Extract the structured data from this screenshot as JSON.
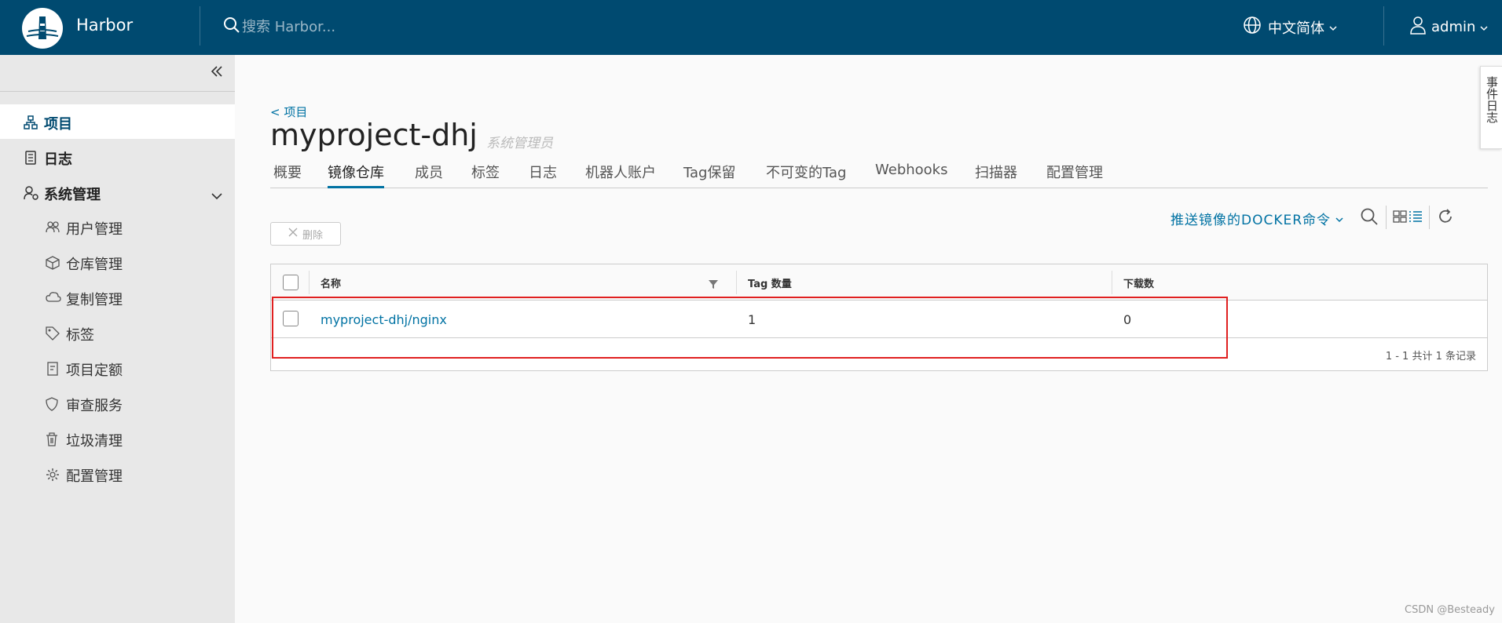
{
  "header": {
    "app_title": "Harbor",
    "search_placeholder": "搜索 Harbor...",
    "language": "中文简体",
    "user": "admin"
  },
  "sidebar": {
    "items": [
      {
        "label": "项目",
        "icon": "projects-icon"
      },
      {
        "label": "日志",
        "icon": "logs-icon"
      },
      {
        "label": "系统管理",
        "icon": "system-admin-icon"
      }
    ],
    "sub_items": [
      {
        "label": "用户管理",
        "icon": "users-icon"
      },
      {
        "label": "仓库管理",
        "icon": "registries-icon"
      },
      {
        "label": "复制管理",
        "icon": "replication-icon"
      },
      {
        "label": "标签",
        "icon": "tag-icon"
      },
      {
        "label": "项目定额",
        "icon": "quota-icon"
      },
      {
        "label": "审查服务",
        "icon": "shield-icon"
      },
      {
        "label": "垃圾清理",
        "icon": "trash-icon"
      },
      {
        "label": "配置管理",
        "icon": "gear-icon"
      }
    ]
  },
  "main": {
    "breadcrumb": "< 项目",
    "title": "myproject-dhj",
    "role": "系统管理员",
    "tabs": [
      "概要",
      "镜像仓库",
      "成员",
      "标签",
      "日志",
      "机器人账户",
      "Tag保留",
      "不可变的Tag",
      "Webhooks",
      "扫描器",
      "配置管理"
    ],
    "active_tab": "镜像仓库",
    "push_command": "推送镜像的DOCKER命令",
    "delete_label": "删除",
    "columns": [
      "名称",
      "Tag 数量",
      "下载数"
    ],
    "rows": [
      {
        "name": "myproject-dhj/nginx",
        "tags": "1",
        "pulls": "0"
      }
    ],
    "footer": "1 - 1 共计 1 条记录"
  },
  "event_log": "事件日志",
  "watermark": "CSDN @Besteady",
  "colors": {
    "header": "#004a70",
    "accent": "#0072a3",
    "highlight": "#e02020"
  }
}
